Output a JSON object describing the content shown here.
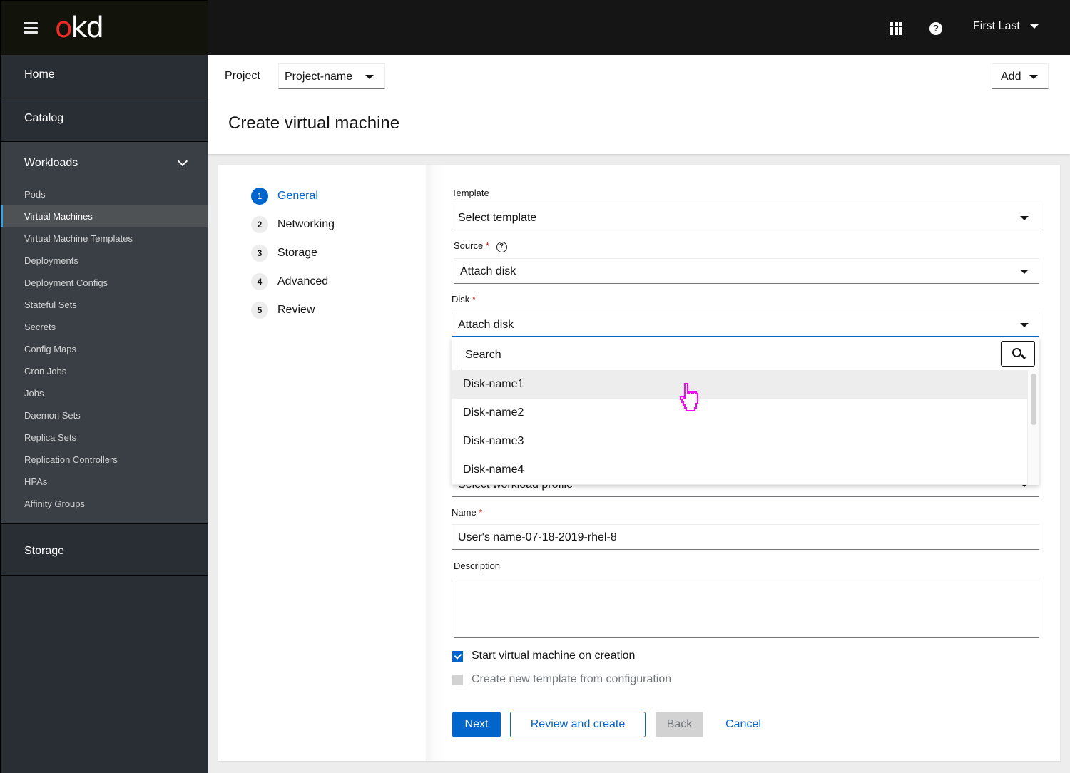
{
  "masthead": {
    "logo_o": "o",
    "logo_kd": "kd",
    "user_name": "First Last"
  },
  "sidebar": {
    "sections": [
      {
        "label": "Home"
      },
      {
        "label": "Catalog"
      },
      {
        "label": "Workloads",
        "expanded": true
      },
      {
        "label": "Storage"
      }
    ],
    "workloads_items": [
      {
        "label": "Pods"
      },
      {
        "label": "Virtual Machines",
        "active": true
      },
      {
        "label": "Virtual Machine Templates"
      },
      {
        "label": "Deployments"
      },
      {
        "label": "Deployment Configs"
      },
      {
        "label": "Stateful Sets"
      },
      {
        "label": "Secrets"
      },
      {
        "label": "Config Maps"
      },
      {
        "label": "Cron Jobs"
      },
      {
        "label": "Jobs"
      },
      {
        "label": "Daemon Sets"
      },
      {
        "label": "Replica Sets"
      },
      {
        "label": "Replication Controllers"
      },
      {
        "label": "HPAs"
      },
      {
        "label": "Affinity Groups"
      }
    ]
  },
  "header": {
    "project_label": "Project",
    "project_value": "Project-name",
    "add_label": "Add",
    "title": "Create virtual machine"
  },
  "wizard": {
    "steps": [
      {
        "num": "1",
        "label": "General",
        "current": true
      },
      {
        "num": "2",
        "label": "Networking"
      },
      {
        "num": "3",
        "label": "Storage"
      },
      {
        "num": "4",
        "label": "Advanced"
      },
      {
        "num": "5",
        "label": "Review"
      }
    ],
    "form": {
      "template_label": "Template",
      "template_value": "Select template",
      "source_label": "Source",
      "source_value": "Attach disk",
      "disk_label": "Disk",
      "disk_value": "Attach disk",
      "required_mark": "*",
      "help_glyph": "?",
      "workload_profile_value": "Select workload profile",
      "name_label": "Name",
      "name_value": "User's name-07-18-2019-rhel-8",
      "description_label": "Description",
      "description_value": "",
      "start_vm_label": "Start virtual machine on creation",
      "start_vm_checked": true,
      "create_template_label": "Create new template from configuration",
      "create_template_checked": false,
      "create_template_disabled": true
    },
    "disk_dropdown": {
      "search_placeholder": "Search",
      "items": [
        "Disk-name1",
        "Disk-name2",
        "Disk-name3",
        "Disk-name4"
      ],
      "hovered_index": 0
    },
    "buttons": {
      "next": "Next",
      "review_create": "Review and create",
      "back": "Back",
      "cancel": "Cancel"
    }
  },
  "colors": {
    "accent": "#0066cc",
    "required": "#c9190b",
    "logo_red": "#ee2a24",
    "sidebar_bg": "#292e34",
    "active_bar": "#39a5dc"
  }
}
